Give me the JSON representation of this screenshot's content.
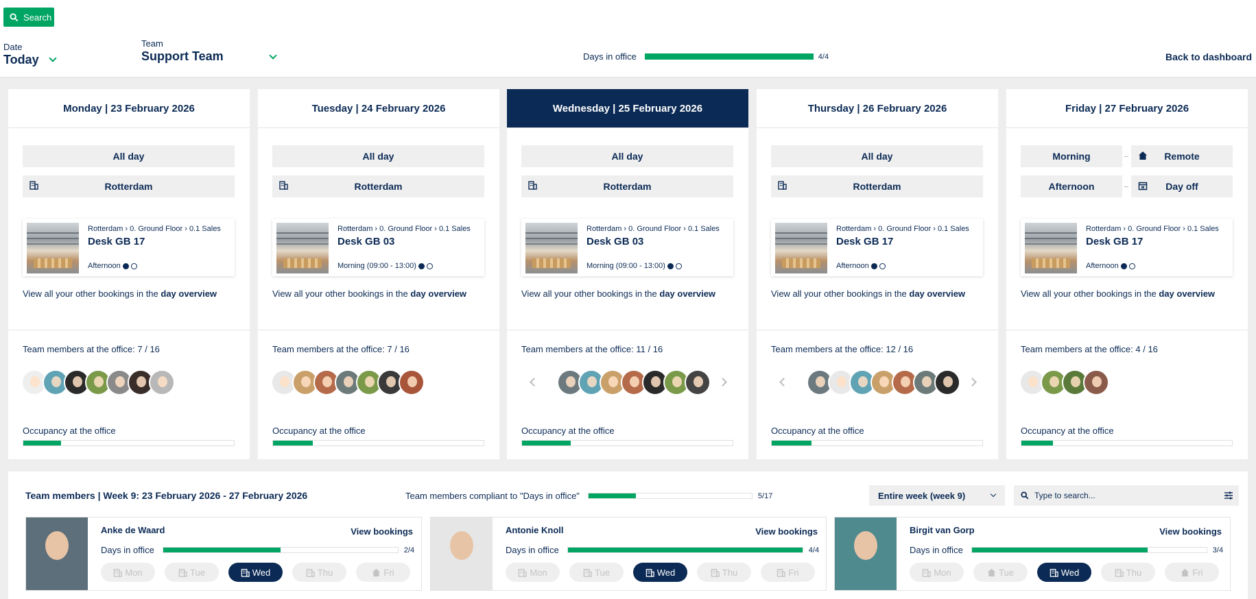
{
  "toolbar": {
    "search_label": "Search"
  },
  "filters": {
    "date": {
      "label": "Date",
      "value": "Today"
    },
    "team": {
      "label": "Team",
      "value": "Support Team"
    }
  },
  "days_in_office": {
    "label": "Days in office",
    "value": "4/4",
    "progress": 1.0
  },
  "back_label": "Back to dashboard",
  "colors": {
    "navy": "#0b2a55",
    "green": "#00a563",
    "grey": "#efefef"
  },
  "overview_text": "View all your other bookings in the ",
  "overview_link": "day overview",
  "occupancy_label": "Occupancy at the office",
  "days": [
    {
      "header": "Monday | 23 February 2026",
      "slot": "All day",
      "location": "Rotterdam",
      "booking": {
        "crumb": "Rotterdam  ›  0. Ground Floor  ›  0.1 Sales",
        "desk": "Desk GB 17",
        "time": "Afternoon"
      },
      "team_label": "Team members at the office: 7 / 16",
      "occupancy": 0.18
    },
    {
      "header": "Tuesday | 24 February 2026",
      "slot": "All day",
      "location": "Rotterdam",
      "booking": {
        "crumb": "Rotterdam  ›  0. Ground Floor  ›  0.1 Sales",
        "desk": "Desk GB 03",
        "time": "Morning (09:00 - 13:00)"
      },
      "team_label": "Team members at the office: 7 / 16",
      "occupancy": 0.19
    },
    {
      "header": "Wednesday | 25 February 2026",
      "slot": "All day",
      "location": "Rotterdam",
      "booking": {
        "crumb": "Rotterdam  ›  0. Ground Floor  ›  0.1 Sales",
        "desk": "Desk GB 03",
        "time": "Morning (09:00 - 13:00)"
      },
      "team_label": "Team members at the office: 11 / 16",
      "occupancy": 0.23
    },
    {
      "header": "Thursday | 26 February 2026",
      "slot": "All day",
      "location": "Rotterdam",
      "booking": {
        "crumb": "Rotterdam  ›  0. Ground Floor  ›  0.1 Sales",
        "desk": "Desk GB 17",
        "time": "Afternoon"
      },
      "team_label": "Team members at the office: 12 / 16",
      "occupancy": 0.19
    },
    {
      "header": "Friday | 27 February 2026",
      "morning": "Morning",
      "morning_status": "Remote",
      "afternoon": "Afternoon",
      "afternoon_status": "Day off",
      "booking": {
        "crumb": "Rotterdam  ›  0. Ground Floor  ›  0.1 Sales",
        "desk": "Desk GB 17",
        "time": "Afternoon"
      },
      "team_label": "Team members at the office: 4 / 16",
      "occupancy": 0.15
    }
  ],
  "team_section": {
    "title": "Team members | Week 9: 23 February 2026 - 27 February 2026",
    "compliant_label": "Team members compliant to \"Days in office\"",
    "compliant_value": "5/17",
    "compliant_progress": 0.29,
    "week_select": "Entire week (week 9)",
    "search_placeholder": "Type to search...",
    "members": [
      {
        "name": "Anke de Waard",
        "view": "View bookings",
        "dio_label": "Days in office",
        "dio_value": "2/4",
        "progress": 0.5,
        "days": [
          "Mon",
          "Tue",
          "Wed",
          "Thu",
          "Fri"
        ]
      },
      {
        "name": "Antonie Knoll",
        "view": "View bookings",
        "dio_label": "Days in office",
        "dio_value": "4/4",
        "progress": 1.0,
        "days": [
          "Mon",
          "Tue",
          "Wed",
          "Thu",
          "Fri"
        ]
      },
      {
        "name": "Birgit van Gorp",
        "view": "View bookings",
        "dio_label": "Days in office",
        "dio_value": "3/4",
        "progress": 0.75,
        "days": [
          "Mon",
          "Tue",
          "Wed",
          "Thu",
          "Fri"
        ]
      }
    ]
  }
}
